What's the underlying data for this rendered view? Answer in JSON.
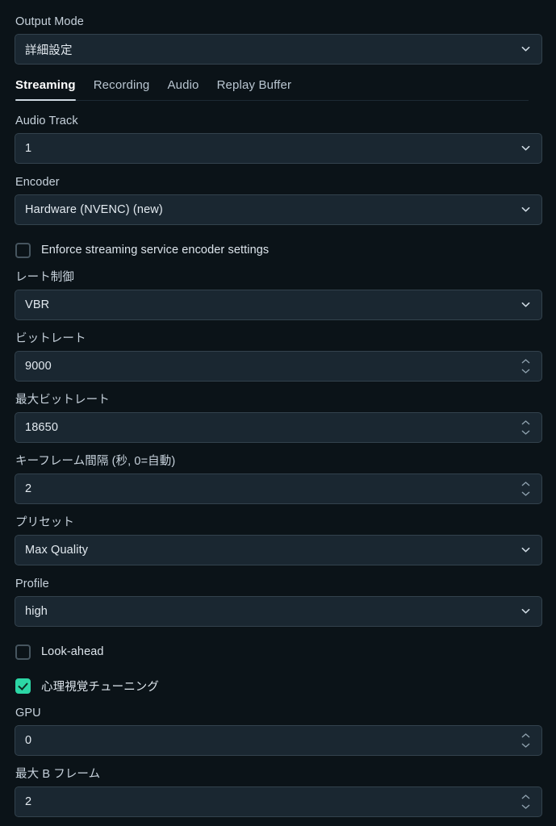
{
  "theme": {
    "page_bg": "#0b1318",
    "field_bg": "#1a2731",
    "field_border": "#33424d",
    "text": "#e3eaf0",
    "label": "#c7d2dc",
    "accent_checked": "#2cd6a5",
    "tab_active_underline": "#cfd9e2"
  },
  "output_mode": {
    "label": "Output Mode",
    "value": "詳細設定"
  },
  "tabs": [
    {
      "label": "Streaming",
      "active": true
    },
    {
      "label": "Recording",
      "active": false
    },
    {
      "label": "Audio",
      "active": false
    },
    {
      "label": "Replay Buffer",
      "active": false
    }
  ],
  "fields": {
    "audio_track": {
      "label": "Audio Track",
      "value": "1",
      "type": "select"
    },
    "encoder": {
      "label": "Encoder",
      "value": "Hardware (NVENC) (new)",
      "type": "select"
    },
    "enforce": {
      "label": "Enforce streaming service encoder settings",
      "checked": false,
      "type": "checkbox"
    },
    "rate_control": {
      "label": "レート制御",
      "value": "VBR",
      "type": "select"
    },
    "bitrate": {
      "label": "ビットレート",
      "value": "9000",
      "type": "number"
    },
    "max_bitrate": {
      "label": "最大ビットレート",
      "value": "18650",
      "type": "number"
    },
    "keyframe_interval": {
      "label": "キーフレーム間隔 (秒, 0=自動)",
      "value": "2",
      "type": "number"
    },
    "preset": {
      "label": "プリセット",
      "value": "Max Quality",
      "type": "select"
    },
    "profile": {
      "label": "Profile",
      "value": "high",
      "type": "select"
    },
    "look_ahead": {
      "label": "Look-ahead",
      "checked": false,
      "type": "checkbox"
    },
    "psycho_visual_tuning": {
      "label": "心理視覚チューニング",
      "checked": true,
      "type": "checkbox"
    },
    "gpu": {
      "label": "GPU",
      "value": "0",
      "type": "number"
    },
    "max_b_frames": {
      "label": "最大 B フレーム",
      "value": "2",
      "type": "number"
    }
  },
  "icons": {
    "chevron_down": "chevron-down-icon",
    "spinner_up": "spinner-up-icon",
    "spinner_down": "spinner-down-icon",
    "checkmark": "checkmark-icon"
  }
}
